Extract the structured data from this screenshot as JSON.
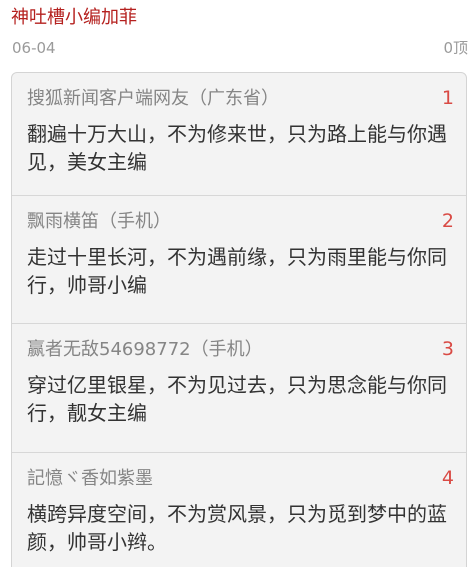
{
  "header": {
    "author": "神吐槽小编加菲",
    "date": "06-04",
    "upvote_label": "0顶"
  },
  "comments": [
    {
      "commenter": "搜狐新闻客户端网友（广东省）",
      "floor": "1",
      "text": "翻遍十万大山，不为修来世，只为路上能与你遇见，美女主编"
    },
    {
      "commenter": "飘雨横笛（手机）",
      "floor": "2",
      "text": "走过十里长河，不为遇前缘，只为雨里能与你同行，帅哥小编"
    },
    {
      "commenter": "赢者无敌54698772（手机）",
      "floor": "3",
      "text": "穿过亿里银星，不为见过去，只为思念能与你同行，靓女主编"
    },
    {
      "commenter": "記憶ヾ香如紫墨",
      "floor": "4",
      "text": "横跨异度空间，不为赏风景，只为觅到梦中的蓝颜，帅哥小辫。"
    }
  ],
  "colors": {
    "author": "#b5211f",
    "floor": "#d94a44",
    "card_background": "#f3f3f3",
    "text": "#333333",
    "muted": "#858585"
  }
}
